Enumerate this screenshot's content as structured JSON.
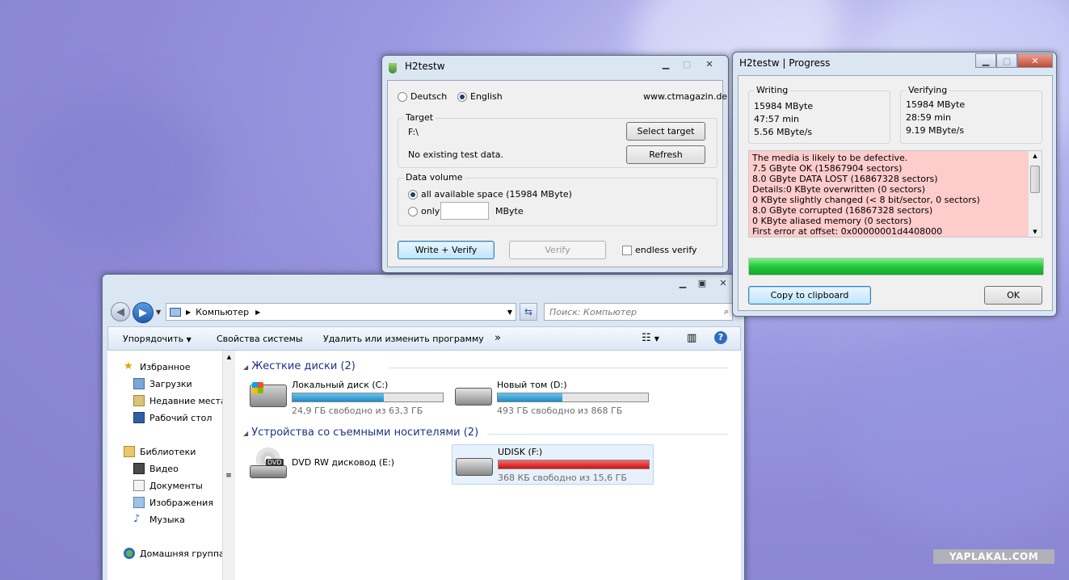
{
  "h2testw": {
    "title": "H2testw",
    "lang_deutsch": "Deutsch",
    "lang_english": "English",
    "website": "www.ctmagazin.de",
    "target_label": "Target",
    "target_value": "F:\\",
    "select_target": "Select target",
    "status": "No existing test data.",
    "refresh": "Refresh",
    "data_volume_label": "Data volume",
    "opt_all": "all available space (15984 MByte)",
    "opt_only": "only",
    "only_value": "",
    "mbyte": "MByte",
    "write_verify": "Write + Verify",
    "verify": "Verify",
    "endless_verify": "endless verify"
  },
  "progress": {
    "title": "H2testw | Progress",
    "writing_label": "Writing",
    "writing": [
      "15984 MByte",
      "47:57 min",
      "5.56 MByte/s"
    ],
    "verifying_label": "Verifying",
    "verifying": [
      "15984 MByte",
      "28:59 min",
      "9.19 MByte/s"
    ],
    "log": [
      "The media is likely to be defective.",
      "7.5 GByte OK (15867904 sectors)",
      "8.0 GByte DATA LOST (16867328 sectors)",
      "Details:0 KByte overwritten (0 sectors)",
      "0 KByte slightly changed (< 8 bit/sector, 0 sectors)",
      "8.0 GByte corrupted (16867328 sectors)",
      "0 KByte aliased memory (0 sectors)",
      "First error at offset: 0x00000001d4408000"
    ],
    "progress_fraction": 1.0,
    "copy_clipboard": "Copy to clipboard",
    "ok": "OK"
  },
  "explorer": {
    "address": "Компьютер",
    "search_placeholder": "Поиск: Компьютер",
    "toolbar": {
      "organize": "Упорядочить",
      "system_properties": "Свойства системы",
      "uninstall": "Удалить или изменить программу",
      "more": "»"
    },
    "nav": {
      "favorites": "Избранное",
      "downloads": "Загрузки",
      "recent": "Недавние места",
      "desktop": "Рабочий стол",
      "libraries": "Библиотеки",
      "video": "Видео",
      "documents": "Документы",
      "images": "Изображения",
      "music": "Музыка",
      "homegroup": "Домашняя группа"
    },
    "hdd_group": "Жесткие диски (2)",
    "removable_group": "Устройства со съемными носителями (2)",
    "drives": {
      "c_name": "Локальный диск (C:)",
      "c_free": "24,9 ГБ свободно из 63,3 ГБ",
      "c_used_fraction": 0.61,
      "d_name": "Новый том (D:)",
      "d_free": "493 ГБ свободно из 868 ГБ",
      "d_used_fraction": 0.43,
      "e_name": "DVD RW дисковод (E:)",
      "e_badge": "DVD",
      "f_name": "UDISK (F:)",
      "f_free": "368 КБ свободно из 15,6 ГБ",
      "f_used_fraction": 1.0
    }
  },
  "watermark": "YAPLAKAL.COM",
  "colors": {
    "log_bg": "#ffcccc",
    "progress_green": "#22c93a",
    "drive_bar_blue": "#1f8cc7",
    "drive_bar_red": "#cc1212"
  }
}
